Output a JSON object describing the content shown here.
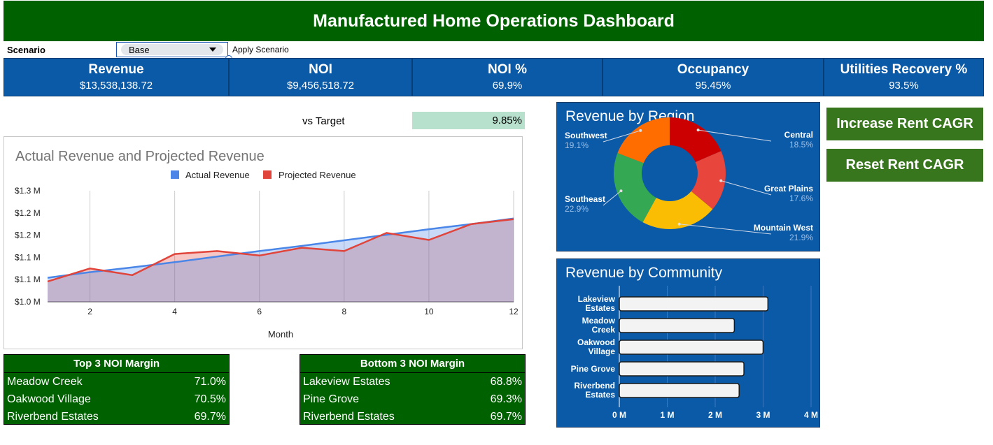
{
  "header": {
    "title": "Manufactured Home Operations Dashboard"
  },
  "scenario": {
    "label": "Scenario",
    "selected": "Base",
    "apply_label": "Apply Scenario"
  },
  "kpis": [
    {
      "label": "Revenue",
      "value": "$13,538,138.72"
    },
    {
      "label": "NOI",
      "value": "$9,456,518.72"
    },
    {
      "label": "NOI %",
      "value": "69.9%"
    },
    {
      "label": "Occupancy",
      "value": "95.45%"
    },
    {
      "label": "Utilities Recovery %",
      "value": "93.5%"
    }
  ],
  "vs_target": {
    "label": "vs Target",
    "value": "9.85%"
  },
  "buttons": {
    "increase": "Increase Rent CAGR",
    "reset": "Reset Rent CAGR"
  },
  "top3": {
    "title": "Top 3 NOI Margin",
    "rows": [
      {
        "name": "Meadow Creek",
        "value": "71.0%"
      },
      {
        "name": "Oakwood Village",
        "value": "70.5%"
      },
      {
        "name": "Riverbend Estates",
        "value": "69.7%"
      }
    ]
  },
  "bottom3": {
    "title": "Bottom 3 NOI Margin",
    "rows": [
      {
        "name": "Lakeview Estates",
        "value": "68.8%"
      },
      {
        "name": "Pine Grove",
        "value": "69.3%"
      },
      {
        "name": "Riverbend Estates",
        "value": "69.7%"
      }
    ]
  },
  "colors": {
    "header_green": "#006100",
    "kpi_blue": "#0b5aa8",
    "button_green": "#38761d",
    "target_fill": "#b7e1cd"
  },
  "chart_data": [
    {
      "type": "area",
      "title": "Actual Revenue and Projected Revenue",
      "xlabel": "Month",
      "ylabel": "",
      "x": [
        1,
        2,
        3,
        4,
        5,
        6,
        7,
        8,
        9,
        10,
        11,
        12
      ],
      "x_ticks": [
        2,
        4,
        6,
        8,
        10,
        12
      ],
      "xlim": [
        1,
        12
      ],
      "ylim": [
        1.0,
        1.3
      ],
      "y_tick_labels": [
        "$1.0 M",
        "$1.1 M",
        "$1.1 M",
        "$1.2 M",
        "$1.2 M",
        "$1.3 M"
      ],
      "legend": "top",
      "grid": "vertical",
      "series": [
        {
          "name": "Actual Revenue",
          "color": "#4a86e8",
          "values": [
            1.065,
            1.08,
            1.093,
            1.107,
            1.122,
            1.137,
            1.151,
            1.166,
            1.181,
            1.196,
            1.21,
            1.225
          ]
        },
        {
          "name": "Projected Revenue",
          "color": "#e0443a",
          "values": [
            1.055,
            1.09,
            1.072,
            1.129,
            1.137,
            1.125,
            1.146,
            1.137,
            1.186,
            1.167,
            1.21,
            1.223
          ]
        }
      ]
    },
    {
      "type": "pie",
      "title": "Revenue by Region",
      "legend": "labels",
      "slices": [
        {
          "label": "Central",
          "value": 18.5,
          "display": "18.5%",
          "color": "#cc0000"
        },
        {
          "label": "Great Plains",
          "value": 17.6,
          "display": "17.6%",
          "color": "#e8453c"
        },
        {
          "label": "Mountain West",
          "value": 21.9,
          "display": "21.9%",
          "color": "#fbbc04"
        },
        {
          "label": "Southeast",
          "value": 22.9,
          "display": "22.9%",
          "color": "#34a853"
        },
        {
          "label": "Southwest",
          "value": 19.1,
          "display": "19.1%",
          "color": "#ff6d01"
        }
      ]
    },
    {
      "type": "bar",
      "orientation": "horizontal",
      "title": "Revenue by Community",
      "categories": [
        "Lakeview Estates",
        "Meadow Creek",
        "Oakwood Village",
        "Pine Grove",
        "Riverbend Estates"
      ],
      "values": [
        3.1,
        2.4,
        3.0,
        2.6,
        2.5
      ],
      "xlim": [
        0,
        4
      ],
      "x_tick_labels": [
        "0 M",
        "1 M",
        "2 M",
        "3 M",
        "4 M"
      ],
      "xlabel": "",
      "ylabel": ""
    }
  ]
}
